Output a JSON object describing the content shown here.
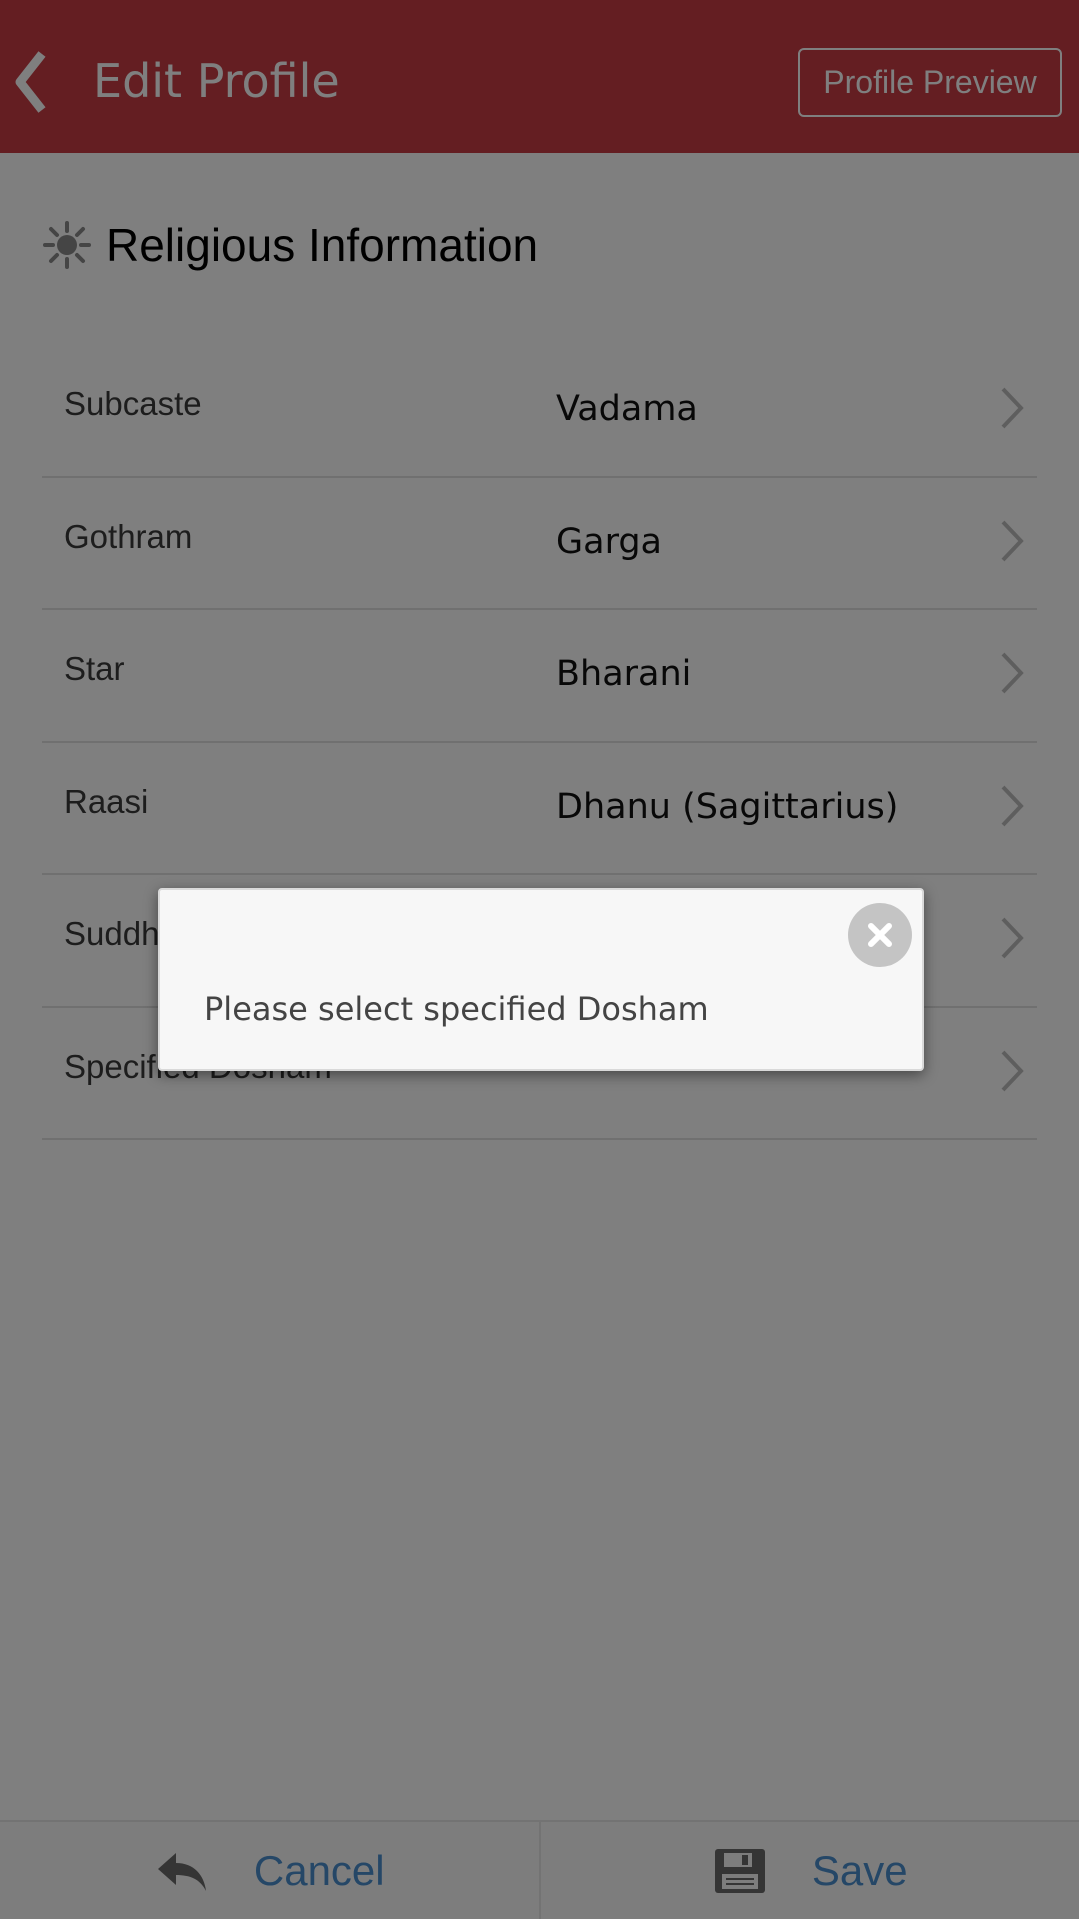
{
  "header": {
    "title": "Edit Profile",
    "preview_label": "Profile Preview",
    "bg_color": "#c83c45"
  },
  "section": {
    "title": "Religious Information"
  },
  "rows": [
    {
      "label": "Subcaste",
      "value": "Vadama"
    },
    {
      "label": "Gothram",
      "value": "Garga"
    },
    {
      "label": "Star",
      "value": "Bharani"
    },
    {
      "label": "Raasi",
      "value": "Dhanu (Sagittarius)"
    },
    {
      "label": "Suddha Jadhagam",
      "value": ""
    },
    {
      "label": "Specified Dosham",
      "value": ""
    }
  ],
  "footer": {
    "cancel_label": "Cancel",
    "save_label": "Save",
    "accent_color": "#4a8fcf"
  },
  "dialog": {
    "message": "Please select specified Dosham"
  }
}
